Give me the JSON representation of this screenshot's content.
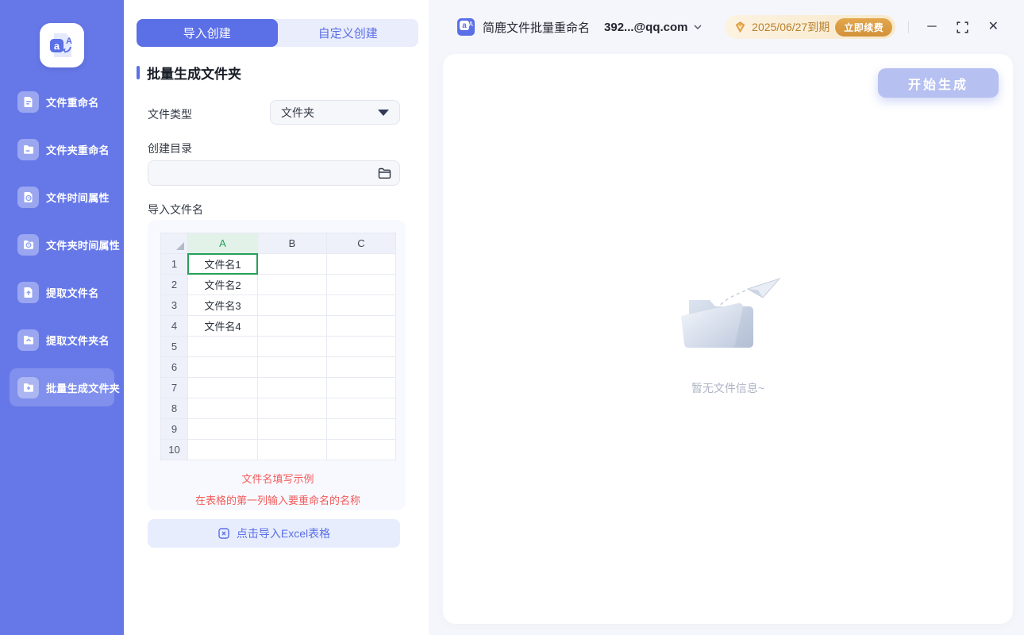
{
  "app": {
    "title": "简鹿文件批量重命名",
    "account": "392...@qq.com",
    "license": {
      "expiry": "2025/06/27到期",
      "renew_label": "立即续费"
    }
  },
  "sidebar": {
    "items": [
      {
        "label": "文件重命名",
        "icon": "file-rename-icon",
        "active": false
      },
      {
        "label": "文件夹重命名",
        "icon": "folder-rename-icon",
        "active": false
      },
      {
        "label": "文件时间属性",
        "icon": "file-time-icon",
        "active": false
      },
      {
        "label": "文件夹时间属性",
        "icon": "folder-time-icon",
        "active": false
      },
      {
        "label": "提取文件名",
        "icon": "file-extract-icon",
        "active": false
      },
      {
        "label": "提取文件夹名",
        "icon": "folder-extract-icon",
        "active": false
      },
      {
        "label": "批量生成文件夹",
        "icon": "folder-create-icon",
        "active": true
      }
    ]
  },
  "panel": {
    "tabs": [
      {
        "label": "导入创建",
        "active": true
      },
      {
        "label": "自定义创建",
        "active": false
      }
    ],
    "section_title": "批量生成文件夹",
    "file_type": {
      "label": "文件类型",
      "value": "文件夹"
    },
    "create_dir": {
      "label": "创建目录",
      "value": ""
    },
    "import_names_label": "导入文件名",
    "table": {
      "columns": [
        "A",
        "B",
        "C"
      ],
      "rows": [
        {
          "num": "1",
          "name": "文件名1"
        },
        {
          "num": "2",
          "name": "文件名2"
        },
        {
          "num": "3",
          "name": "文件名3"
        },
        {
          "num": "4",
          "name": "文件名4"
        },
        {
          "num": "5",
          "name": ""
        },
        {
          "num": "6",
          "name": ""
        },
        {
          "num": "7",
          "name": ""
        },
        {
          "num": "8",
          "name": ""
        },
        {
          "num": "9",
          "name": ""
        },
        {
          "num": "10",
          "name": ""
        }
      ],
      "selected_cell": "A1"
    },
    "hint_line1": "文件名填写示例",
    "hint_line2": "在表格的第一列输入要重命名的名称",
    "import_button_label": "点击导入Excel表格"
  },
  "main": {
    "generate_button_label": "开始生成",
    "empty_text": "暂无文件信息~"
  },
  "icons": {
    "minimize-icon": "─",
    "close-icon": "✕"
  },
  "colors": {
    "accent": "#5b6fe6",
    "sidebar_bg": "#6678e8",
    "sheet_green": "#26a05a",
    "hint_red": "#f25b5b",
    "license_text": "#b9802e",
    "renew_button": "#d2923a",
    "disabled_button": "#b6c0f1"
  }
}
